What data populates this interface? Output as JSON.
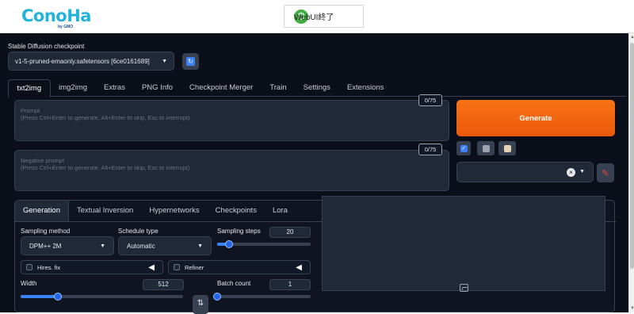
{
  "header": {
    "logo_text": "ConoHa",
    "logo_by": "by GMO",
    "end_button_label": "WebUI終了"
  },
  "checkpoint": {
    "label": "Stable Diffusion checkpoint",
    "value": "v1-5-pruned-emaonly.safetensors [6ce0161689]"
  },
  "tabs": [
    "txt2img",
    "img2img",
    "Extras",
    "PNG Info",
    "Checkpoint Merger",
    "Train",
    "Settings",
    "Extensions"
  ],
  "prompt": {
    "placeholder_title": "Prompt",
    "placeholder_hint": "(Press Ctrl+Enter to generate, Alt+Enter to skip, Esc to interrupt)",
    "counter": "0/75"
  },
  "negative_prompt": {
    "placeholder_title": "Negative prompt",
    "placeholder_hint": "(Press Ctrl+Enter to generate, Alt+Enter to skip, Esc to interrupt)",
    "counter": "0/75"
  },
  "generate_label": "Generate",
  "subtabs": [
    "Generation",
    "Textual Inversion",
    "Hypernetworks",
    "Checkpoints",
    "Lora"
  ],
  "generation": {
    "sampling_method_label": "Sampling method",
    "sampling_method_value": "DPM++ 2M",
    "schedule_type_label": "Schedule type",
    "schedule_type_value": "Automatic",
    "sampling_steps_label": "Sampling steps",
    "sampling_steps_value": "20",
    "sampling_steps_fraction": 0.13,
    "hires_label": "Hires. fix",
    "refiner_label": "Refiner",
    "width_label": "Width",
    "width_value": "512",
    "width_fraction": 0.23,
    "batch_count_label": "Batch count",
    "batch_count_value": "1",
    "batch_count_fraction": 0.0
  },
  "colors": {
    "accent_orange": "#ea580c",
    "accent_blue": "#3b82f6",
    "logo_cyan": "#23b3d9",
    "background": "#0b0f19"
  },
  "icons": [
    "power-icon",
    "refresh-icon",
    "check-icon",
    "trash-icon",
    "clipboard-icon",
    "clear-icon",
    "paint-brush-icon",
    "swap-icon",
    "image-icon"
  ]
}
